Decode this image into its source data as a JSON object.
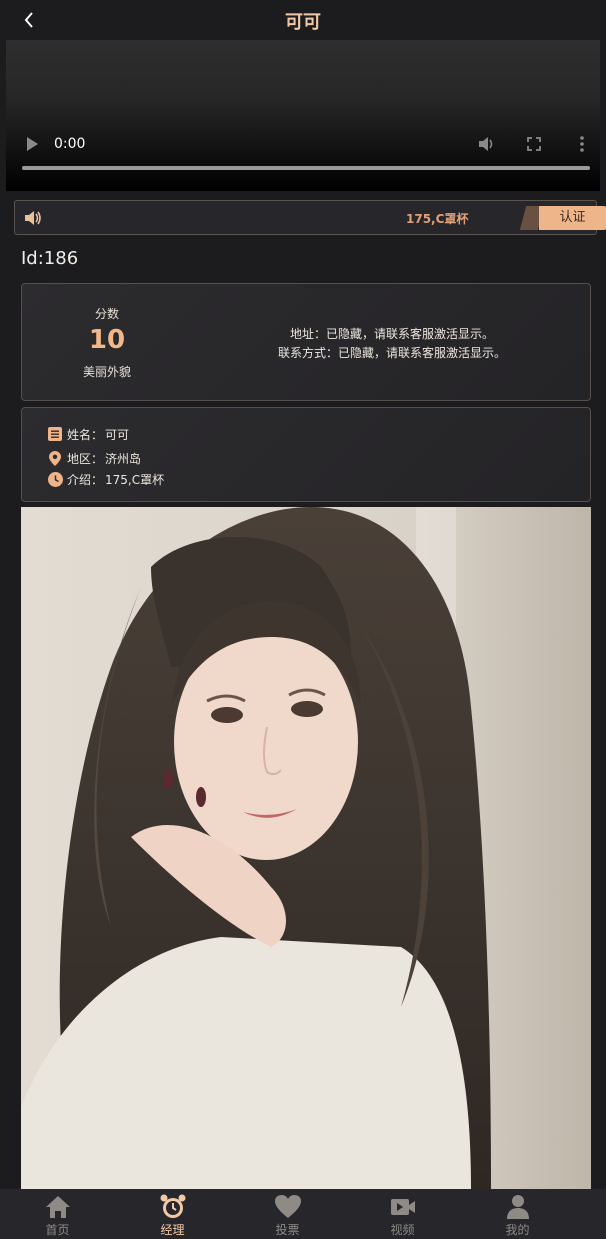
{
  "header": {
    "title": "可可"
  },
  "video": {
    "time": "0:00"
  },
  "notice": {
    "text": "175,C罩杯",
    "verify_label": "认证"
  },
  "profile": {
    "id_text": "Id:186",
    "score_label": "分数",
    "score_value": "10",
    "score_sub": "美丽外貌",
    "address": "地址：已隐藏，请联系客服激活显示。",
    "contact": "联系方式：已隐藏，请联系客服激活显示。",
    "name_label": "姓名：",
    "name_value": "可可",
    "region_label": "地区：",
    "region_value": "济州岛",
    "intro_label": "介绍：",
    "intro_value": "175,C罩杯"
  },
  "tabs": [
    {
      "label": "首页",
      "icon": "home-icon"
    },
    {
      "label": "经理",
      "icon": "alarm-clock-icon"
    },
    {
      "label": "投票",
      "icon": "heart-icon"
    },
    {
      "label": "视频",
      "icon": "video-camera-icon"
    },
    {
      "label": "我的",
      "icon": "user-icon"
    }
  ],
  "colors": {
    "accent": "#f0b88a",
    "background": "#1c1b1e",
    "card": "#2a292c",
    "tab_inactive": "#8e8a86"
  }
}
